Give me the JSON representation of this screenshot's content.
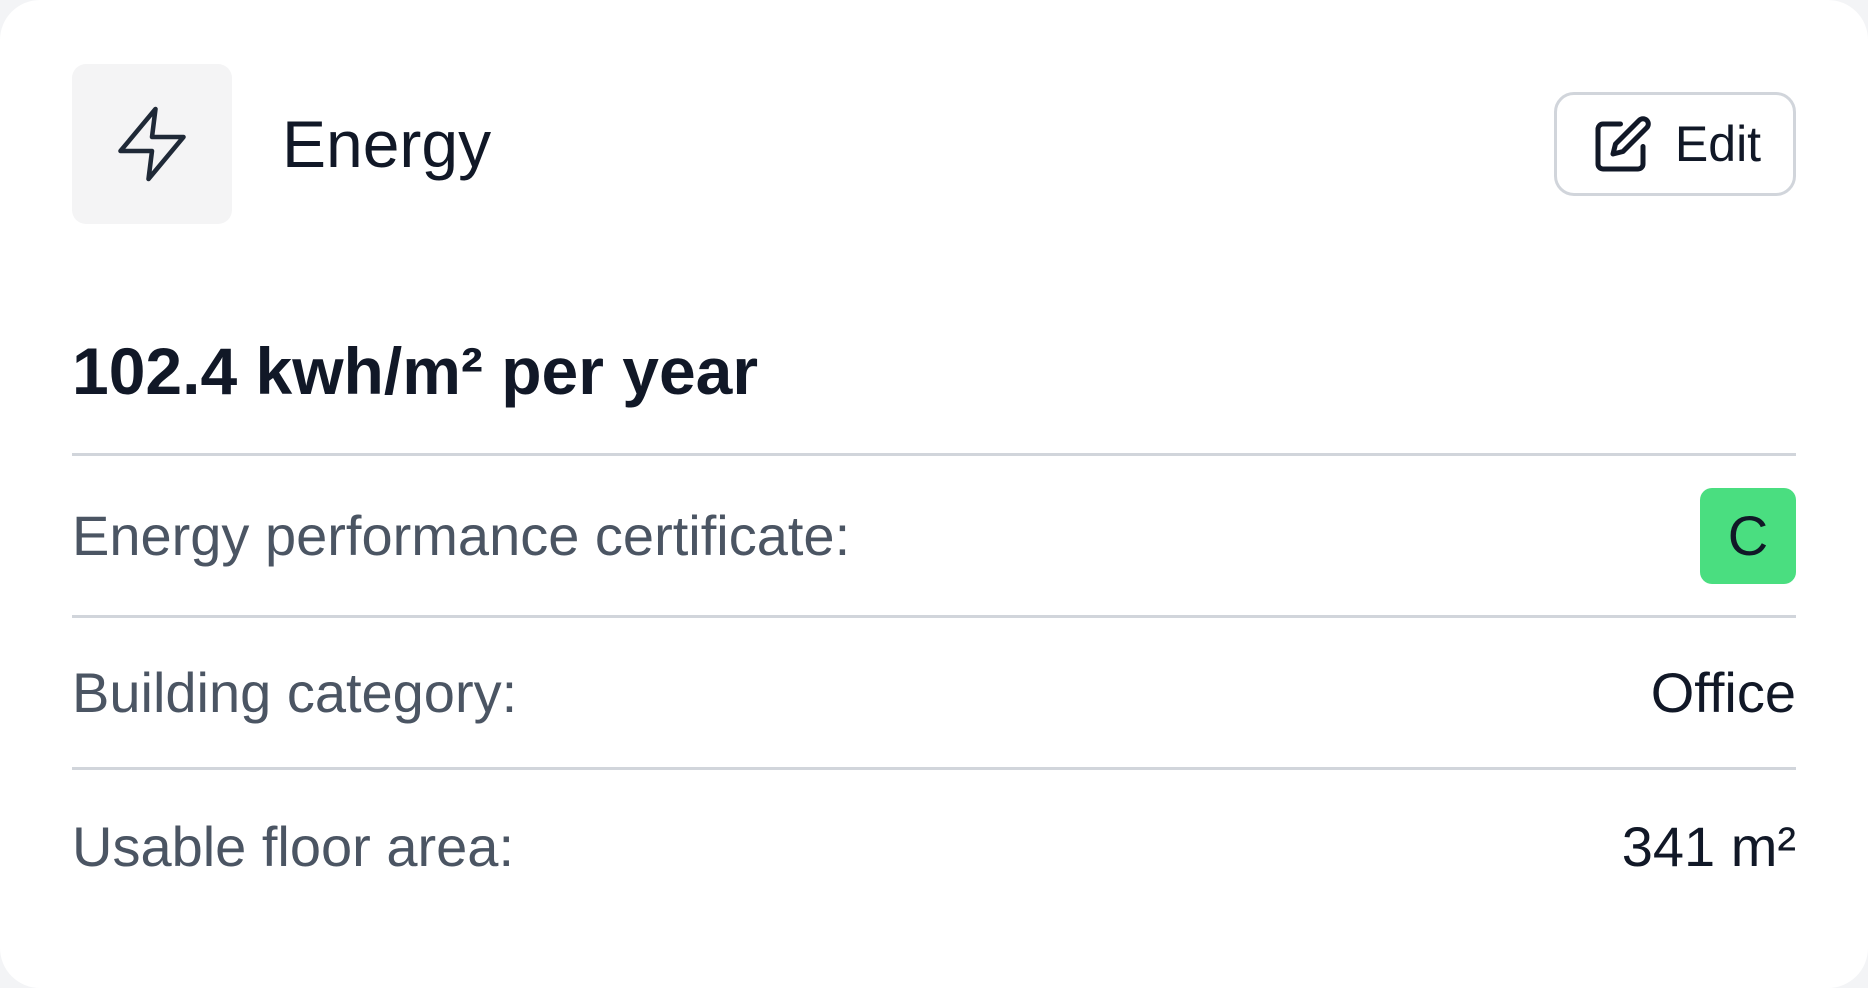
{
  "card": {
    "title": "Energy",
    "icon": "lightning-bolt-icon",
    "edit_button": {
      "label": "Edit",
      "icon": "edit-pencil-square-icon"
    },
    "summary": "102.4 kwh/m² per year",
    "rows": [
      {
        "label": "Energy performance certificate:",
        "value": "C",
        "badge_color": "#4ade80"
      },
      {
        "label": "Building category:",
        "value": "Office"
      },
      {
        "label": "Usable floor area:",
        "value": "341 m²"
      }
    ]
  },
  "colors": {
    "text_primary": "#111827",
    "text_secondary": "#4b5563",
    "divider": "#d1d5db",
    "icon_box_bg": "#f4f4f5",
    "epc_badge": "#4ade80"
  }
}
